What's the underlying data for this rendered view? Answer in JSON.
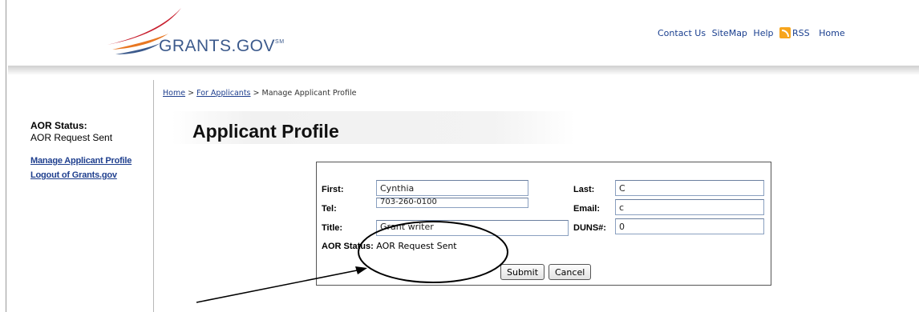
{
  "header": {
    "logo_text": "GRANTS.GOV",
    "logo_mark": "SM",
    "links": {
      "contact": "Contact Us",
      "sitemap": "SiteMap",
      "help": "Help",
      "rss": "RSS",
      "home": "Home"
    }
  },
  "sidebar": {
    "aor_label": "AOR Status:",
    "aor_value": "AOR Request Sent",
    "links": {
      "manage": "Manage Applicant Profile",
      "logout": "Logout of Grants.gov"
    }
  },
  "breadcrumb": {
    "home": "Home",
    "sep1": " > ",
    "applicants": "For Applicants",
    "sep2": " > ",
    "current": "Manage Applicant Profile"
  },
  "page_title": "Applicant Profile",
  "form": {
    "first_label": "First:",
    "first_value": "Cynthia",
    "last_label": "Last:",
    "last_value": "C",
    "tel_label": "Tel:",
    "tel_value": "703-260-0100",
    "email_label": "Email:",
    "email_value": "c",
    "title_label": "Title:",
    "title_value": "Grant writer",
    "duns_label": "DUNS#:",
    "duns_value": "0",
    "aor_label": "AOR Status:",
    "aor_value": "AOR Request Sent",
    "submit_label": "Submit",
    "cancel_label": "Cancel"
  },
  "colors": {
    "link_blue": "#1f3f8e",
    "logo_blue": "#3c5a8c",
    "logo_red": "#c8202f",
    "logo_orange": "#e87722",
    "rss_orange": "#f7a51c"
  }
}
